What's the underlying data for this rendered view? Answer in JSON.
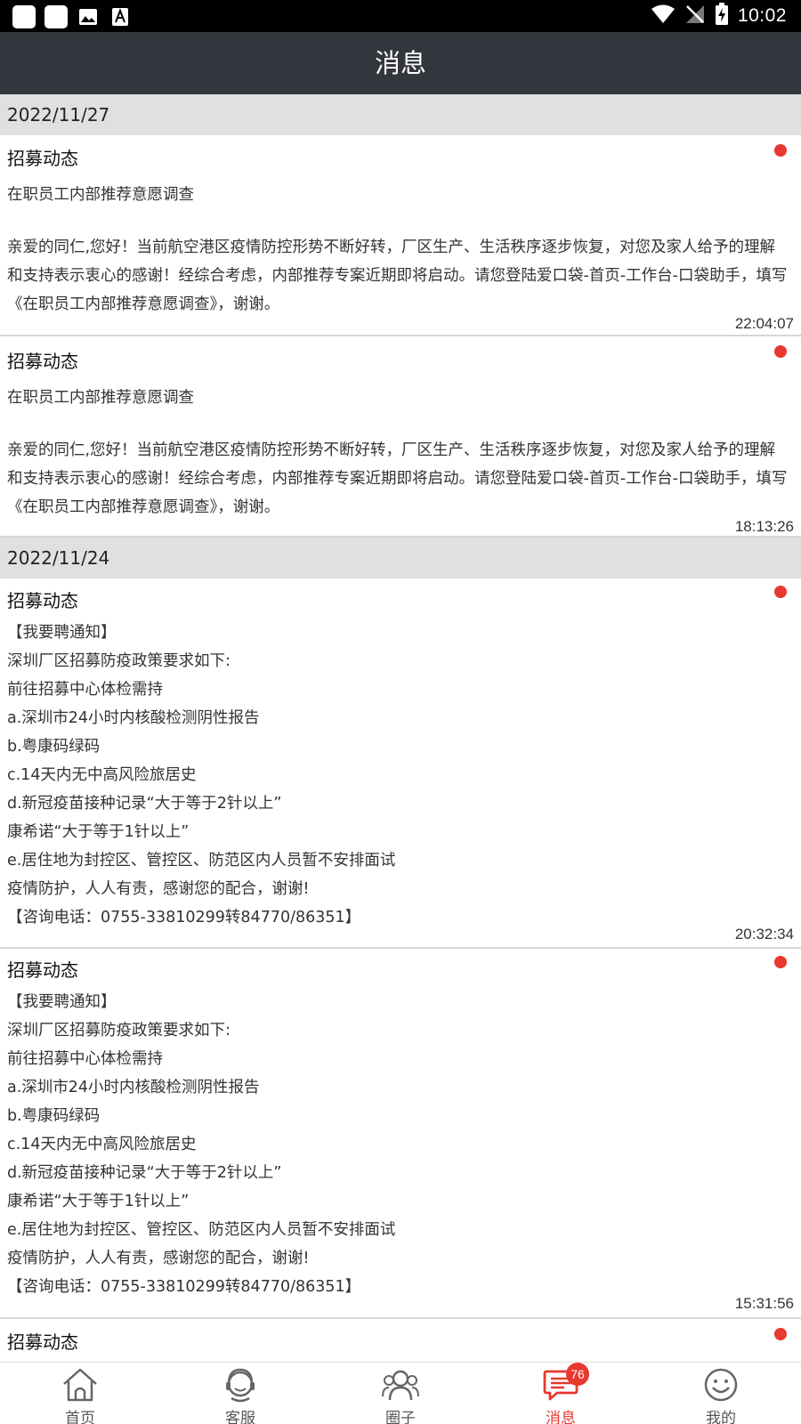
{
  "status_bar": {
    "time": "10:02",
    "left_icons": [
      "app-icon",
      "app-icon",
      "image-icon",
      "font-icon"
    ],
    "right_icons": [
      "wifi-icon",
      "no-signal-icon",
      "battery-charging-icon"
    ]
  },
  "header": {
    "title": "消息"
  },
  "sections": [
    {
      "date": "2022/11/27",
      "messages": [
        {
          "title": "招募动态",
          "subtitle": "在职员工内部推荐意愿调查",
          "body": "亲爱的同仁,您好！当前航空港区疫情防控形势不断好转，厂区生产、生活秩序逐步恢复，对您及家人给予的理解和支持表示衷心的感谢！经综合考虑，内部推荐专案近期即将启动。请您登陆爱口袋-首页-工作台-口袋助手，填写《在职员工内部推荐意愿调查》，谢谢。",
          "time": "22:04:07",
          "unread": true
        },
        {
          "title": "招募动态",
          "subtitle": "在职员工内部推荐意愿调查",
          "body": "亲爱的同仁,您好！当前航空港区疫情防控形势不断好转，厂区生产、生活秩序逐步恢复，对您及家人给予的理解和支持表示衷心的感谢！经综合考虑，内部推荐专案近期即将启动。请您登陆爱口袋-首页-工作台-口袋助手，填写《在职员工内部推荐意愿调查》，谢谢。",
          "time": "18:13:26",
          "unread": true
        }
      ]
    },
    {
      "date": "2022/11/24",
      "messages": [
        {
          "title": "招募动态",
          "body": "【我要聘通知】\n深圳厂区招募防疫政策要求如下:\n前往招募中心体检需持\na.深圳市24小时内核酸检测阴性报告\nb.粤康码绿码\nc.14天内无中高风险旅居史\nd.新冠疫苗接种记录“大于等于2针以上”\n  康希诺“大于等于1针以上”\ne.居住地为封控区、管控区、防范区内人员暂不安排面试\n疫情防护，人人有责，感谢您的配合，谢谢!\n【咨询电话：0755-33810299转84770/86351】",
          "time": "20:32:34",
          "unread": true
        },
        {
          "title": "招募动态",
          "body": "【我要聘通知】\n深圳厂区招募防疫政策要求如下:\n前往招募中心体检需持\na.深圳市24小时内核酸检测阴性报告\nb.粤康码绿码\nc.14天内无中高风险旅居史\nd.新冠疫苗接种记录“大于等于2针以上”\n  康希诺“大于等于1针以上”\ne.居住地为封控区、管控区、防范区内人员暂不安排面试\n疫情防护，人人有责，感谢您的配合，谢谢!\n【咨询电话：0755-33810299转84770/86351】",
          "time": "15:31:56",
          "unread": true
        },
        {
          "title": "招募动态",
          "unread": true
        }
      ]
    }
  ],
  "bottom_nav": {
    "items": [
      {
        "label": "首页",
        "icon": "home-icon",
        "active": false
      },
      {
        "label": "客服",
        "icon": "customer-service-icon",
        "active": false
      },
      {
        "label": "圈子",
        "icon": "community-icon",
        "active": false
      },
      {
        "label": "消息",
        "icon": "message-icon",
        "active": true,
        "badge": "76"
      },
      {
        "label": "我的",
        "icon": "profile-icon",
        "active": false
      }
    ]
  },
  "colors": {
    "header_bg": "#34363d",
    "date_header_bg": "#dfe0e0",
    "accent_red": "#e8382f",
    "status_bar_bg": "#000000"
  }
}
